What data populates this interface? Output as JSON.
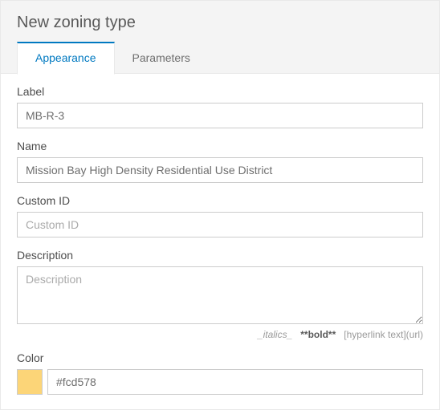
{
  "panel": {
    "title": "New zoning type"
  },
  "tabs": {
    "appearance": "Appearance",
    "parameters": "Parameters"
  },
  "fields": {
    "label": {
      "label": "Label",
      "value": "MB-R-3"
    },
    "name": {
      "label": "Name",
      "value": "Mission Bay High Density Residential Use District"
    },
    "customId": {
      "label": "Custom ID",
      "value": "",
      "placeholder": "Custom ID"
    },
    "description": {
      "label": "Description",
      "value": "",
      "placeholder": "Description",
      "hints": {
        "italics": "_italics_",
        "bold": "**bold**",
        "link": "[hyperlink text](url)"
      }
    },
    "color": {
      "label": "Color",
      "value": "#fcd578",
      "swatch": "#fcd578"
    }
  }
}
